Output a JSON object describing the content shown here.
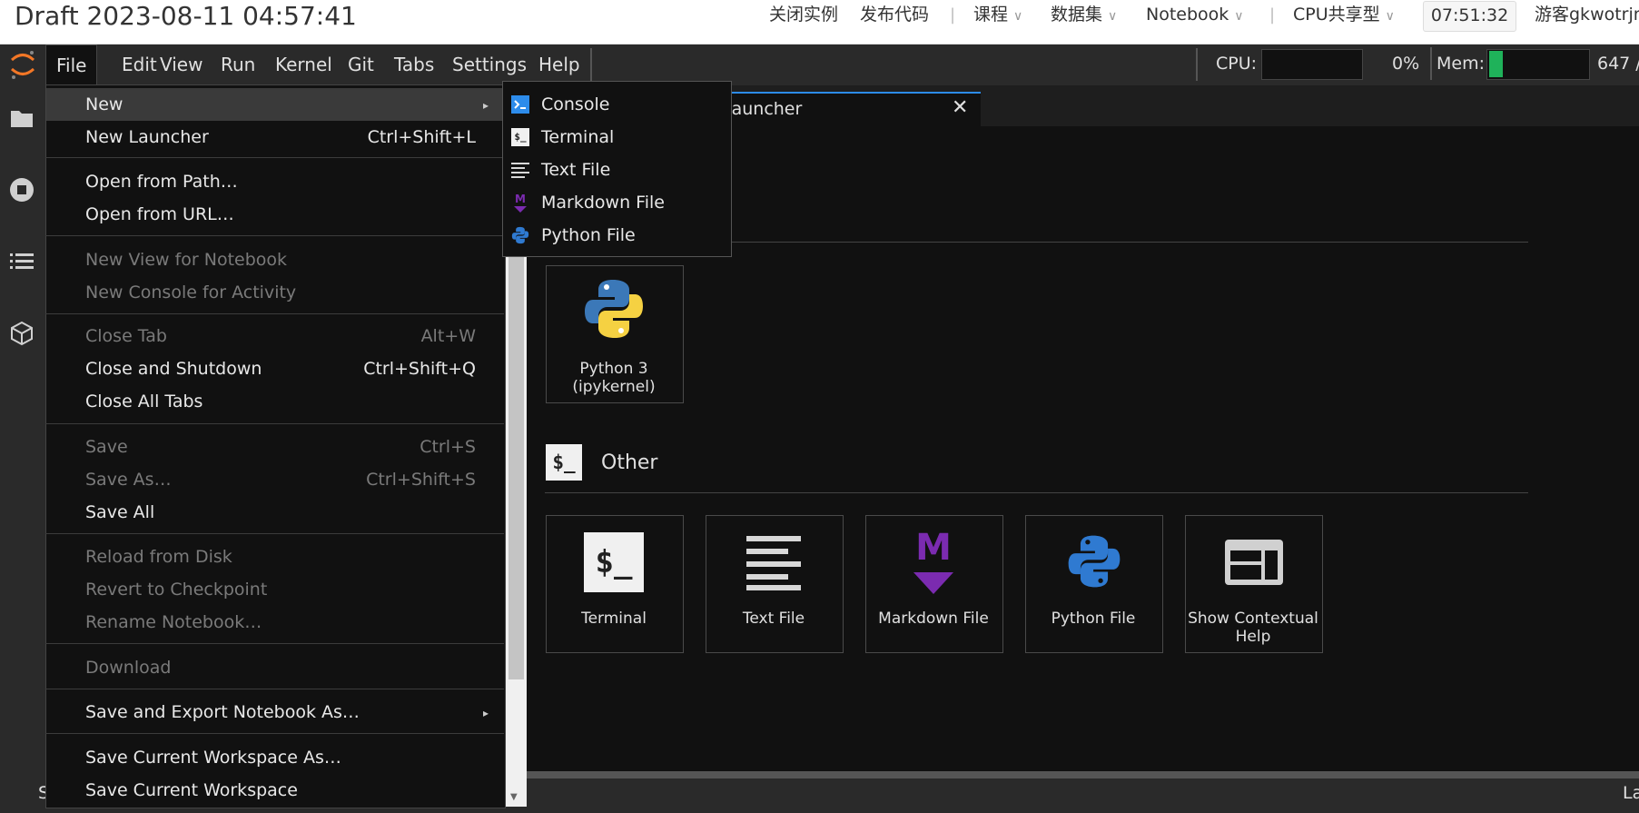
{
  "header": {
    "draft_title": "Draft 2023-08-11 04:57:41",
    "links": [
      "关闭实例",
      "发布代码"
    ],
    "dropdowns": [
      "课程",
      "数据集",
      "Notebook"
    ],
    "resource": "CPU共享型",
    "timer": "07:51:32",
    "user": "游客gkwotrjnt"
  },
  "menubar": {
    "items": [
      "File",
      "Edit",
      "View",
      "Run",
      "Kernel",
      "Git",
      "Tabs",
      "Settings",
      "Help"
    ],
    "cpu_label": "CPU:",
    "cpu_value": "0%",
    "mem_label": "Mem:",
    "mem_value": "647 /"
  },
  "tab": {
    "label": "Launcher"
  },
  "launcher": {
    "notebook_card_label": "Python 3 (ipykernel)",
    "other_heading": "Other",
    "other_icon_text": "$_",
    "other_cards": [
      "Terminal",
      "Text File",
      "Markdown File",
      "Python File",
      "Show Contextual Help"
    ]
  },
  "file_menu": {
    "new": "New",
    "new_launcher": "New Launcher",
    "new_launcher_sc": "Ctrl+Shift+L",
    "open_path": "Open from Path…",
    "open_url": "Open from URL…",
    "new_view": "New View for Notebook",
    "new_console": "New Console for Activity",
    "close_tab": "Close Tab",
    "close_tab_sc": "Alt+W",
    "close_shutdown": "Close and Shutdown",
    "close_shutdown_sc": "Ctrl+Shift+Q",
    "close_all": "Close All Tabs",
    "save": "Save",
    "save_sc": "Ctrl+S",
    "save_as": "Save As…",
    "save_as_sc": "Ctrl+Shift+S",
    "save_all": "Save All",
    "reload": "Reload from Disk",
    "revert": "Revert to Checkpoint",
    "rename": "Rename Notebook…",
    "download": "Download",
    "export": "Save and Export Notebook As…",
    "save_ws_as": "Save Current Workspace As…",
    "save_ws": "Save Current Workspace"
  },
  "new_submenu": {
    "items": [
      "Console",
      "Terminal",
      "Text File",
      "Markdown File",
      "Python File"
    ]
  },
  "statusbar": {
    "left": "S",
    "right": "La"
  },
  "colors": {
    "accent": "#2d8ceb",
    "mem_bar": "#1fb25a",
    "markdown": "#7b2bb0",
    "python_blue": "#2f7ad1",
    "python_yellow": "#f5d142"
  }
}
